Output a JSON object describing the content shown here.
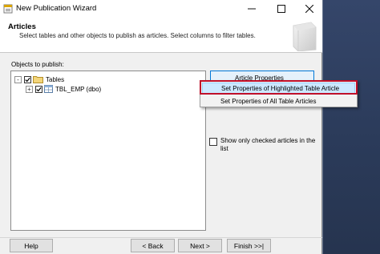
{
  "window": {
    "title": "New Publication Wizard"
  },
  "header": {
    "title": "Articles",
    "subtitle": "Select tables and other objects to publish as articles. Select columns to filter tables."
  },
  "objects": {
    "label": "Objects to publish:",
    "tree": [
      {
        "label": "Tables",
        "expander": "-",
        "checked": true,
        "icon": "folder-icon"
      },
      {
        "label": "TBL_EMP (dbo)",
        "expander": "+",
        "checked": true,
        "icon": "table-icon"
      }
    ]
  },
  "article_button": {
    "label": "Article Properties"
  },
  "context_menu": {
    "items": [
      {
        "label": "Set Properties of Highlighted Table Article",
        "highlighted": true
      },
      {
        "label": "Set Properties of All Table Articles",
        "highlighted": false
      }
    ]
  },
  "options": {
    "show_only_checked": "Show only checked articles in the list",
    "show_only_checked_value": false
  },
  "footer": {
    "help": "Help",
    "back": "< Back",
    "next": "Next >",
    "finish": "Finish >>|"
  },
  "colors": {
    "highlight_fill": "#cce8ff",
    "callout_border": "#c0102a",
    "desktop": "#2e3f5c"
  }
}
